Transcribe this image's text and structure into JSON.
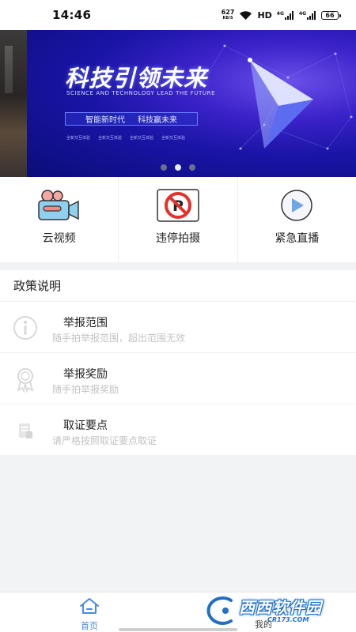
{
  "status_bar": {
    "time": "14:46",
    "net_speed": "627",
    "net_unit": "KB/S",
    "hd": "HD",
    "signal_label_1": "4G",
    "signal_label_2": "4G",
    "battery": "66"
  },
  "banner": {
    "title": "科技引领未来",
    "subtitle": "SCIENCE AND TECHNOLOGY LEAD THE FUTURE",
    "tag_left": "智能新时代",
    "tag_right": "科技赢未来",
    "mini_1": "全新交互体验",
    "mini_2": "全新交互体验",
    "mini_3": "全新交互体验",
    "mini_4": "全新交互体验",
    "slide_count": 3,
    "active_slide": 2
  },
  "quick_actions": [
    {
      "label": "云视频",
      "icon": "camera-icon"
    },
    {
      "label": "违停拍摄",
      "icon": "no-parking-icon"
    },
    {
      "label": "紧急直播",
      "icon": "play-icon"
    }
  ],
  "policy": {
    "heading": "政策说明",
    "items": [
      {
        "title": "举报范围",
        "desc": "随手拍举报范围，超出范围无效",
        "icon": "info-icon"
      },
      {
        "title": "举报奖励",
        "desc": "随手拍举报奖励",
        "icon": "award-icon"
      },
      {
        "title": "取证要点",
        "desc": "请严格按照取证要点取证",
        "icon": "document-icon"
      }
    ]
  },
  "bottom_nav": {
    "home_label": "首页",
    "mine_label": "我的",
    "accent": "#4a8ad9"
  },
  "watermark": {
    "text": "西西软件园",
    "url_text": "CR173.COM",
    "color": "#1f6fc9"
  }
}
